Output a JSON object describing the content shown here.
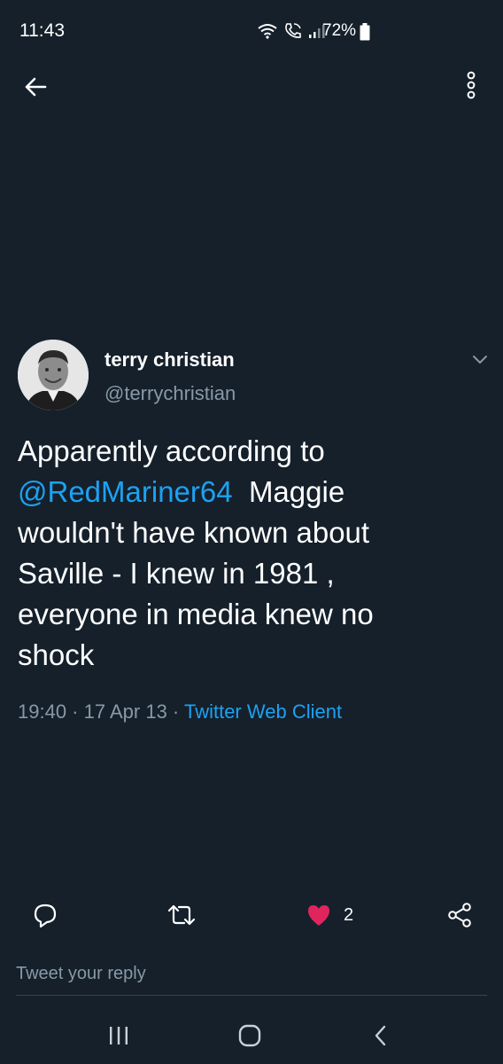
{
  "status_bar": {
    "time": "11:43",
    "battery": "72%",
    "icons": [
      "wifi-icon",
      "wifi-calling-icon",
      "signal-icon",
      "battery-icon"
    ]
  },
  "top_bar": {
    "back_icon": "arrow-left-icon",
    "more_icon": "more-vertical-icon"
  },
  "tweet": {
    "author": {
      "display_name": "terry christian",
      "handle": "@terrychristian"
    },
    "text_lines": [
      {
        "parts": [
          {
            "text": "Apparently according to",
            "type": "text"
          }
        ]
      },
      {
        "parts": [
          {
            "text": "@RedMariner64",
            "type": "mention"
          },
          {
            "text": "  Maggie",
            "type": "text"
          }
        ]
      },
      {
        "parts": [
          {
            "text": "wouldn't have known about",
            "type": "text"
          }
        ]
      },
      {
        "parts": [
          {
            "text": "Saville - I knew in 1981 ,",
            "type": "text"
          }
        ]
      },
      {
        "parts": [
          {
            "text": "everyone in media knew no",
            "type": "text"
          }
        ]
      },
      {
        "parts": [
          {
            "text": "shock",
            "type": "text"
          }
        ]
      }
    ],
    "meta": {
      "time": "19:40",
      "separator": " · ",
      "date": "17 Apr 13",
      "source": "Twitter Web Client"
    },
    "actions": {
      "like_count": "2"
    }
  },
  "reply": {
    "placeholder": "Tweet your reply"
  },
  "colors": {
    "background": "#15202b",
    "accent": "#1da1f2",
    "secondary_text": "#8899a6",
    "like": "#e0245e"
  }
}
